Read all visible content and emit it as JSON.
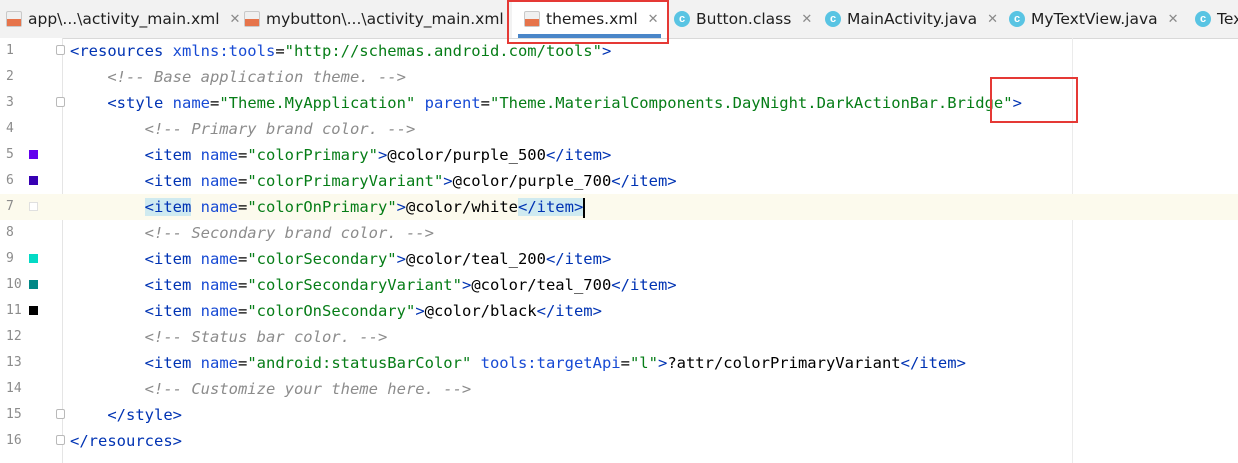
{
  "tabs": [
    {
      "label": "app\\...\\activity_main.xml",
      "icon": "xml-file-icon",
      "active": false
    },
    {
      "label": "mybutton\\...\\activity_main.xml",
      "icon": "xml-file-icon",
      "active": false
    },
    {
      "label": "themes.xml",
      "icon": "xml-file-icon",
      "active": true
    },
    {
      "label": "Button.class",
      "icon": "class-file-icon",
      "active": false
    },
    {
      "label": "MainActivity.java",
      "icon": "java-class-icon",
      "active": false
    },
    {
      "label": "MyTextView.java",
      "icon": "java-class-icon",
      "active": false
    },
    {
      "label": "Tex",
      "icon": "java-class-icon",
      "active": false
    }
  ],
  "close_glyph": "✕",
  "colors": {
    "purple_500": "#6200ee",
    "purple_700": "#3700b3",
    "white": "#ffffff",
    "teal_200": "#03dac5",
    "teal_700": "#018786",
    "black": "#000000",
    "annotation": "#e53935"
  },
  "lines": [
    {
      "n": "1",
      "tokens": [
        {
          "t": "tag",
          "s": "<resources "
        },
        {
          "t": "attr",
          "s": "xmlns:tools"
        },
        {
          "t": "plain",
          "s": "="
        },
        {
          "t": "val",
          "s": "\"http://schemas.android.com/tools\""
        },
        {
          "t": "tag",
          "s": ">"
        }
      ]
    },
    {
      "n": "2",
      "tokens": [
        {
          "t": "plain",
          "s": "    "
        },
        {
          "t": "com",
          "s": "<!-- Base application theme. -->"
        }
      ]
    },
    {
      "n": "3",
      "tokens": [
        {
          "t": "plain",
          "s": "    "
        },
        {
          "t": "tag",
          "s": "<style "
        },
        {
          "t": "attr",
          "s": "name"
        },
        {
          "t": "plain",
          "s": "="
        },
        {
          "t": "val",
          "s": "\"Theme.MyApplication\""
        },
        {
          "t": "plain",
          "s": " "
        },
        {
          "t": "attr",
          "s": "parent"
        },
        {
          "t": "plain",
          "s": "="
        },
        {
          "t": "val",
          "s": "\"Theme.MaterialComponents.DayNight.DarkActionBar.Bridge\""
        },
        {
          "t": "tag",
          "s": ">"
        }
      ]
    },
    {
      "n": "4",
      "tokens": [
        {
          "t": "plain",
          "s": "        "
        },
        {
          "t": "com",
          "s": "<!-- Primary brand color. -->"
        }
      ]
    },
    {
      "n": "5",
      "swatch": "purple_500",
      "tokens": [
        {
          "t": "plain",
          "s": "        "
        },
        {
          "t": "tag",
          "s": "<item "
        },
        {
          "t": "attr",
          "s": "name"
        },
        {
          "t": "plain",
          "s": "="
        },
        {
          "t": "val",
          "s": "\"colorPrimary\""
        },
        {
          "t": "tag",
          "s": ">"
        },
        {
          "t": "plain",
          "s": "@color/purple_500"
        },
        {
          "t": "tag",
          "s": "</item>"
        }
      ]
    },
    {
      "n": "6",
      "swatch": "purple_700",
      "tokens": [
        {
          "t": "plain",
          "s": "        "
        },
        {
          "t": "tag",
          "s": "<item "
        },
        {
          "t": "attr",
          "s": "name"
        },
        {
          "t": "plain",
          "s": "="
        },
        {
          "t": "val",
          "s": "\"colorPrimaryVariant\""
        },
        {
          "t": "tag",
          "s": ">"
        },
        {
          "t": "plain",
          "s": "@color/purple_700"
        },
        {
          "t": "tag",
          "s": "</item>"
        }
      ]
    },
    {
      "n": "7",
      "swatch": "white",
      "current": true,
      "tokens": [
        {
          "t": "plain",
          "s": "        "
        },
        {
          "t": "hltag",
          "s": "<item"
        },
        {
          "t": "plain",
          "s": " "
        },
        {
          "t": "attr",
          "s": "name"
        },
        {
          "t": "plain",
          "s": "="
        },
        {
          "t": "val",
          "s": "\"colorOnPrimary\""
        },
        {
          "t": "tag",
          "s": ">"
        },
        {
          "t": "plain",
          "s": "@color/white"
        },
        {
          "t": "hltag",
          "s": "</item>"
        },
        {
          "t": "caret",
          "s": ""
        }
      ]
    },
    {
      "n": "8",
      "tokens": [
        {
          "t": "plain",
          "s": "        "
        },
        {
          "t": "com",
          "s": "<!-- Secondary brand color. -->"
        }
      ]
    },
    {
      "n": "9",
      "swatch": "teal_200",
      "tokens": [
        {
          "t": "plain",
          "s": "        "
        },
        {
          "t": "tag",
          "s": "<item "
        },
        {
          "t": "attr",
          "s": "name"
        },
        {
          "t": "plain",
          "s": "="
        },
        {
          "t": "val",
          "s": "\"colorSecondary\""
        },
        {
          "t": "tag",
          "s": ">"
        },
        {
          "t": "plain",
          "s": "@color/teal_200"
        },
        {
          "t": "tag",
          "s": "</item>"
        }
      ]
    },
    {
      "n": "10",
      "swatch": "teal_700",
      "tokens": [
        {
          "t": "plain",
          "s": "        "
        },
        {
          "t": "tag",
          "s": "<item "
        },
        {
          "t": "attr",
          "s": "name"
        },
        {
          "t": "plain",
          "s": "="
        },
        {
          "t": "val",
          "s": "\"colorSecondaryVariant\""
        },
        {
          "t": "tag",
          "s": ">"
        },
        {
          "t": "plain",
          "s": "@color/teal_700"
        },
        {
          "t": "tag",
          "s": "</item>"
        }
      ]
    },
    {
      "n": "11",
      "swatch": "black",
      "tokens": [
        {
          "t": "plain",
          "s": "        "
        },
        {
          "t": "tag",
          "s": "<item "
        },
        {
          "t": "attr",
          "s": "name"
        },
        {
          "t": "plain",
          "s": "="
        },
        {
          "t": "val",
          "s": "\"colorOnSecondary\""
        },
        {
          "t": "tag",
          "s": ">"
        },
        {
          "t": "plain",
          "s": "@color/black"
        },
        {
          "t": "tag",
          "s": "</item>"
        }
      ]
    },
    {
      "n": "12",
      "tokens": [
        {
          "t": "plain",
          "s": "        "
        },
        {
          "t": "com",
          "s": "<!-- Status bar color. -->"
        }
      ]
    },
    {
      "n": "13",
      "tokens": [
        {
          "t": "plain",
          "s": "        "
        },
        {
          "t": "tag",
          "s": "<item "
        },
        {
          "t": "attr",
          "s": "name"
        },
        {
          "t": "plain",
          "s": "="
        },
        {
          "t": "val",
          "s": "\"android:statusBarColor\""
        },
        {
          "t": "plain",
          "s": " "
        },
        {
          "t": "attr",
          "s": "tools:targetApi"
        },
        {
          "t": "plain",
          "s": "="
        },
        {
          "t": "val",
          "s": "\"l\""
        },
        {
          "t": "tag",
          "s": ">"
        },
        {
          "t": "plain",
          "s": "?attr/colorPrimaryVariant"
        },
        {
          "t": "tag",
          "s": "</item>"
        }
      ]
    },
    {
      "n": "14",
      "tokens": [
        {
          "t": "plain",
          "s": "        "
        },
        {
          "t": "com",
          "s": "<!-- Customize your theme here. -->"
        }
      ]
    },
    {
      "n": "15",
      "tokens": [
        {
          "t": "plain",
          "s": "    "
        },
        {
          "t": "tag",
          "s": "</style>"
        }
      ]
    },
    {
      "n": "16",
      "tokens": [
        {
          "t": "tag",
          "s": "</resources>"
        }
      ]
    }
  ]
}
